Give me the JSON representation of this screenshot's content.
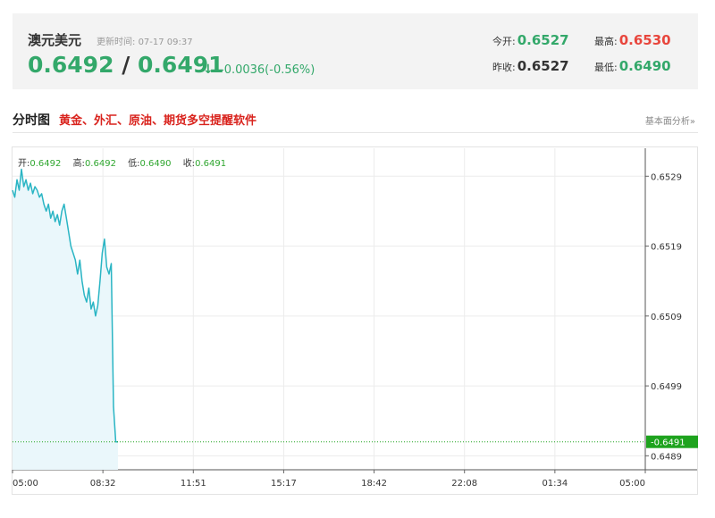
{
  "quote": {
    "name": "澳元美元",
    "update_label": "更新时间:",
    "update_time": "07-17 09:37",
    "bid": "0.6492",
    "ask": "0.6491",
    "direction_symbol": "↓",
    "change": "-0.0036(-0.56%)",
    "stats": {
      "open_label": "今开:",
      "open_value": "0.6527",
      "high_label": "最高:",
      "high_value": "0.6530",
      "prev_close_label": "昨收:",
      "prev_close_value": "0.6527",
      "low_label": "最低:",
      "low_value": "0.6490"
    }
  },
  "section": {
    "title": "分时图",
    "ad_text": "黄金、外汇、原油、期货多空提醒软件",
    "link": "基本面分析»"
  },
  "ohlc_legend": {
    "open_label": "开:",
    "open_value": "0.6492",
    "high_label": "高:",
    "high_value": "0.6492",
    "low_label": "低:",
    "low_value": "0.6490",
    "close_label": "收:",
    "close_value": "0.6491"
  },
  "colors": {
    "up": "#e8463d",
    "down": "#33a86a",
    "line": "#2ab5c4",
    "area": "#eaf7fb",
    "marker": "#1ea31e"
  },
  "chart_data": {
    "type": "line",
    "title": "",
    "xlabel": "",
    "ylabel": "",
    "x_ticks": [
      "05:00",
      "08:32",
      "11:51",
      "15:17",
      "18:42",
      "22:08",
      "01:34",
      "05:00"
    ],
    "y_ticks": [
      "0.6529",
      "0.6519",
      "0.6509",
      "0.6499",
      "0.6489"
    ],
    "ylim": [
      0.6487,
      0.6533
    ],
    "grid": true,
    "current_value": "0.6491",
    "series": [
      {
        "points": [
          [
            0,
            0.6527
          ],
          [
            1,
            0.6526
          ],
          [
            2,
            0.65285
          ],
          [
            3,
            0.6527
          ],
          [
            4,
            0.653
          ],
          [
            5,
            0.65275
          ],
          [
            6,
            0.65285
          ],
          [
            7,
            0.6527
          ],
          [
            8,
            0.6528
          ],
          [
            9,
            0.65265
          ],
          [
            10,
            0.65275
          ],
          [
            11,
            0.6527
          ],
          [
            12,
            0.6526
          ],
          [
            13,
            0.65265
          ],
          [
            14,
            0.6525
          ],
          [
            15,
            0.6524
          ],
          [
            16,
            0.6525
          ],
          [
            17,
            0.6523
          ],
          [
            18,
            0.6524
          ],
          [
            19,
            0.65225
          ],
          [
            20,
            0.65235
          ],
          [
            21,
            0.6522
          ],
          [
            22,
            0.6524
          ],
          [
            23,
            0.6525
          ],
          [
            24,
            0.6523
          ],
          [
            25,
            0.6521
          ],
          [
            26,
            0.6519
          ],
          [
            27,
            0.6518
          ],
          [
            28,
            0.6517
          ],
          [
            29,
            0.6515
          ],
          [
            30,
            0.6517
          ],
          [
            31,
            0.6514
          ],
          [
            32,
            0.6512
          ],
          [
            33,
            0.6511
          ],
          [
            34,
            0.6513
          ],
          [
            35,
            0.651
          ],
          [
            36,
            0.6511
          ],
          [
            37,
            0.6509
          ],
          [
            38,
            0.65105
          ],
          [
            39,
            0.6514
          ],
          [
            40,
            0.6518
          ],
          [
            41,
            0.652
          ],
          [
            42,
            0.6516
          ],
          [
            43,
            0.6515
          ],
          [
            44,
            0.65165
          ],
          [
            45,
            0.6496
          ],
          [
            46,
            0.6491
          ],
          [
            47,
            0.6491
          ]
        ]
      }
    ]
  }
}
